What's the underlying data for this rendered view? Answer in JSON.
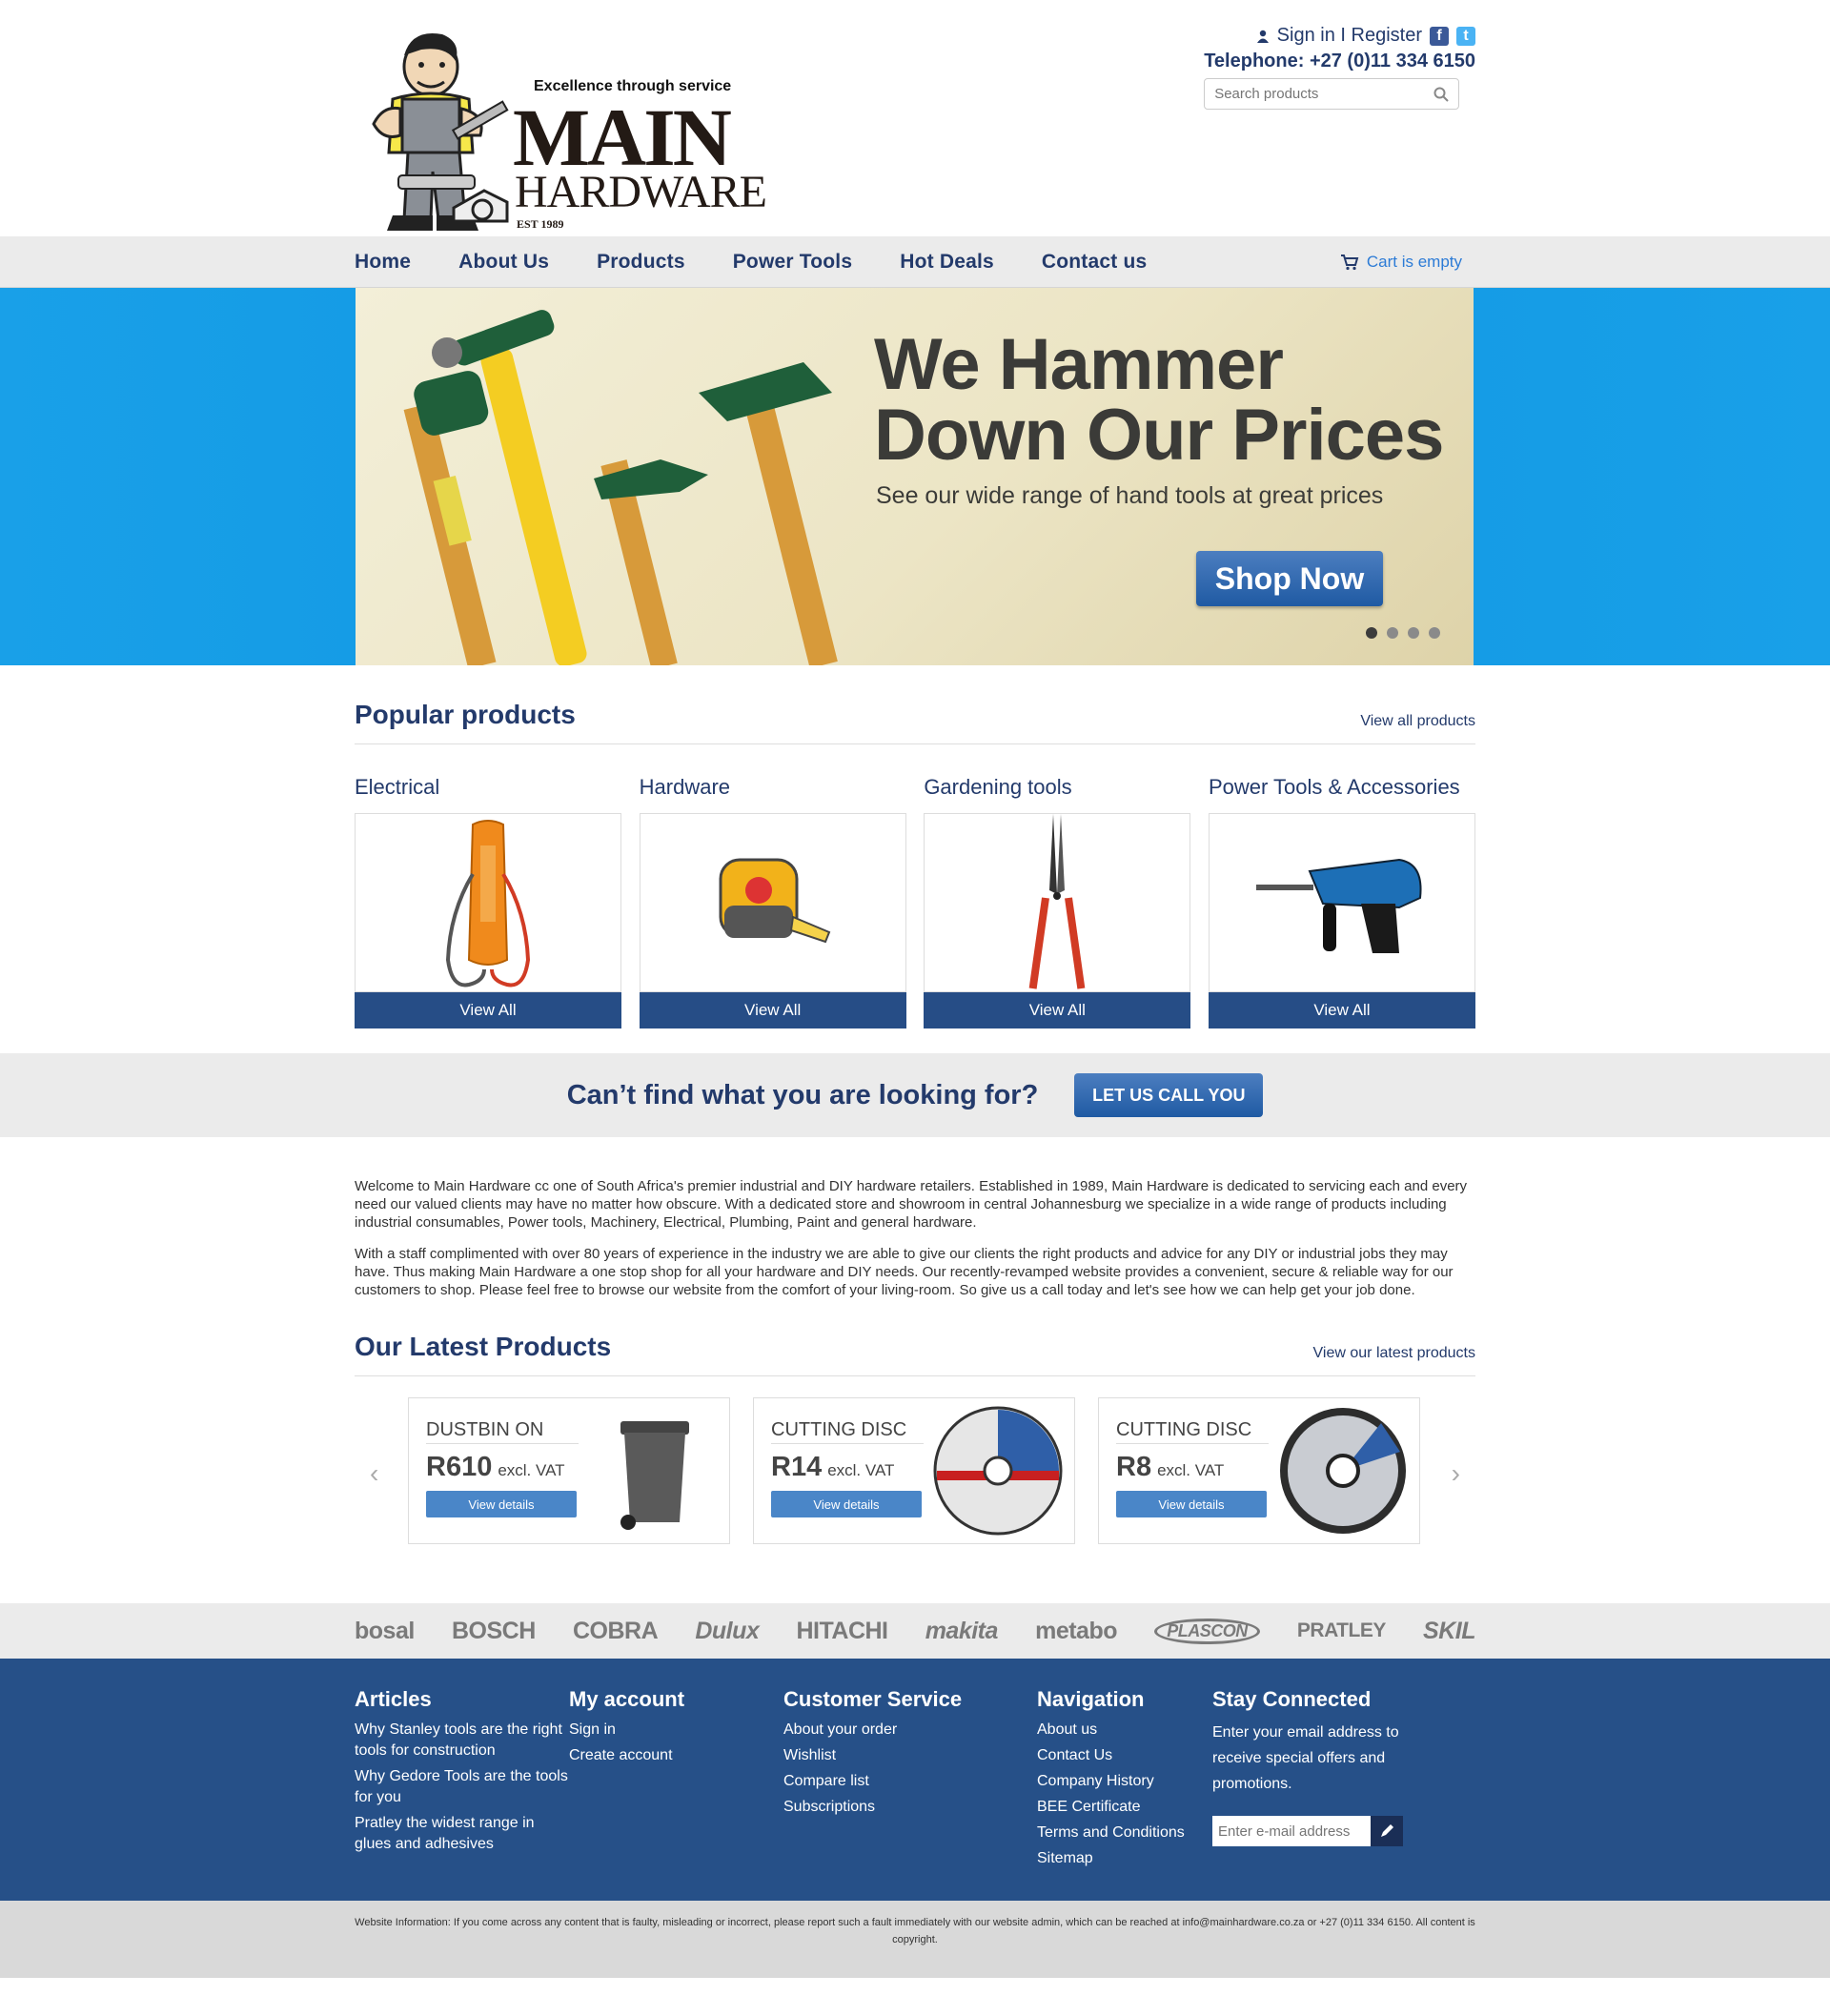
{
  "header": {
    "tagline": "Excellence through service",
    "logo_main": "MAIN",
    "logo_sub": "HARDWARE",
    "logo_est": "EST 1989",
    "signin": "Sign in",
    "separator": "I",
    "register": "Register",
    "telephone": "Telephone: +27 (0)11 334 6150",
    "search_placeholder": "Search products"
  },
  "nav": {
    "items": [
      "Home",
      "About Us",
      "Products",
      "Power Tools",
      "Hot Deals",
      "Contact us"
    ],
    "cart": "Cart is empty"
  },
  "hero": {
    "title_line1": "We Hammer",
    "title_line2": "Down Our Prices",
    "subtitle": "See our wide range of hand tools at great prices",
    "button": "Shop Now",
    "slide_count": 4,
    "active_slide": 1
  },
  "popular": {
    "heading": "Popular products",
    "view_all": "View all products",
    "categories": [
      {
        "name": "Electrical",
        "button": "View All"
      },
      {
        "name": "Hardware",
        "button": "View All"
      },
      {
        "name": "Gardening tools",
        "button": "View All"
      },
      {
        "name": "Power Tools & Accessories",
        "button": "View All"
      }
    ]
  },
  "cta": {
    "text": "Can’t find what you are looking for?",
    "button": "LET US CALL YOU"
  },
  "welcome": {
    "p1": "Welcome to Main Hardware cc one of South Africa's premier industrial and DIY hardware retailers. Established in 1989, Main Hardware is dedicated to servicing each and every need our valued clients may have no matter how obscure. With a dedicated store and showroom in central Johannesburg we specialize in a wide range of products including industrial consumables, Power tools, Machinery, Electrical, Plumbing, Paint and general hardware.",
    "p2": "With a staff complimented with over 80 years of experience in the industry we are able to give our clients the right products and advice for any DIY or industrial jobs they may have. Thus making Main Hardware a one stop shop for all your hardware and DIY needs. Our recently-revamped website provides a convenient, secure & reliable way for our customers to shop. Please feel free to browse our website from the comfort of your living-room. So give us a call today and let's see how we can help get your job done."
  },
  "latest": {
    "heading": "Our Latest Products",
    "view_all": "View our latest products",
    "products": [
      {
        "name": "DUSTBIN ON",
        "price": "R610",
        "vat": "excl. VAT",
        "button": "View details"
      },
      {
        "name": "CUTTING DISC",
        "price": "R14",
        "vat": "excl. VAT",
        "button": "View details"
      },
      {
        "name": "CUTTING DISC",
        "price": "R8",
        "vat": "excl. VAT",
        "button": "View details"
      }
    ]
  },
  "brands": [
    "bosal",
    "BOSCH",
    "COBRA",
    "Dulux",
    "HITACHI",
    "makita",
    "metabo",
    "PLASCON",
    "PRATLEY",
    "SKIL"
  ],
  "footer": {
    "articles": {
      "heading": "Articles",
      "links": [
        "Why Stanley tools are the right tools for construction",
        "Why Gedore Tools are the tools for you",
        "Pratley the widest range in glues and adhesives"
      ]
    },
    "account": {
      "heading": "My account",
      "links": [
        "Sign in",
        "Create account"
      ]
    },
    "service": {
      "heading": "Customer Service",
      "links": [
        "About your order",
        "Wishlist",
        "Compare list",
        "Subscriptions"
      ]
    },
    "navigation": {
      "heading": "Navigation",
      "links": [
        "About us",
        "Contact Us",
        "Company History",
        "BEE Certificate",
        "Terms and Conditions",
        "Sitemap"
      ]
    },
    "connected": {
      "heading": "Stay Connected",
      "text": "Enter your email address to receive special offers and promotions.",
      "placeholder": "Enter e-mail address"
    },
    "disclaimer": "Website Information: If you come across any content that is faulty, misleading or incorrect, please report such a fault immediately with our website admin, which can be reached at info@mainhardware.co.za or +27 (0)11 334 6150.  All content is copyright."
  },
  "colors": {
    "navy": "#233a6b",
    "footer_blue": "#265088",
    "hero_blue": "#1199e6",
    "button_blue": "#264d86",
    "link_blue": "#2c7bd6"
  }
}
